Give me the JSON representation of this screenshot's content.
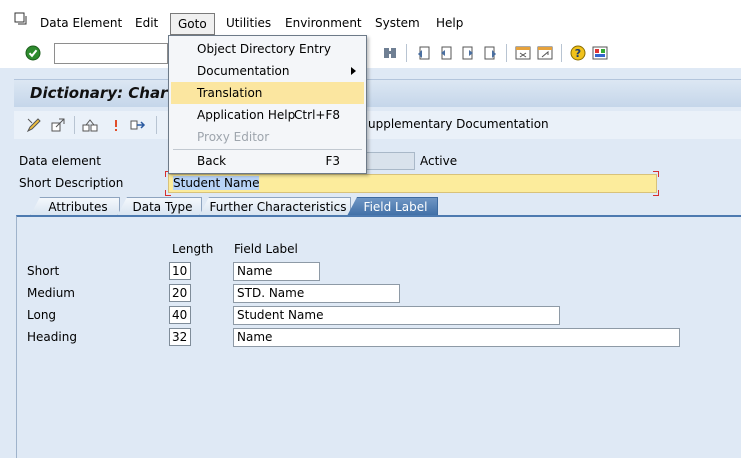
{
  "menubar": {
    "items": [
      {
        "label": "Data Element"
      },
      {
        "label": "Edit"
      },
      {
        "label": "Goto"
      },
      {
        "label": "Utilities"
      },
      {
        "label": "Environment"
      },
      {
        "label": "System"
      },
      {
        "label": "Help"
      }
    ],
    "open_menu": "Goto"
  },
  "goto_menu": {
    "items": [
      {
        "label": "Object Directory Entry",
        "shortcut": "",
        "submenu": false,
        "enabled": true
      },
      {
        "label": "Documentation",
        "shortcut": "",
        "submenu": true,
        "enabled": true
      },
      {
        "label": "Translation",
        "shortcut": "",
        "submenu": false,
        "enabled": true,
        "highlighted": true
      },
      {
        "label": "Application Help",
        "shortcut": "Ctrl+F8",
        "submenu": false,
        "enabled": true
      },
      {
        "label": "Proxy Editor",
        "shortcut": "",
        "submenu": false,
        "enabled": false
      },
      {
        "label": "Back",
        "shortcut": "F3",
        "submenu": false,
        "enabled": true
      }
    ]
  },
  "title": "Dictionary: Char",
  "app_toolbar": {
    "supplementary_doc_label": "upplementary Documentation"
  },
  "header": {
    "data_element_label": "Data element",
    "status": "Active",
    "short_desc_label": "Short Description",
    "short_desc_value": "Student Name"
  },
  "tabs": [
    {
      "label": "Attributes",
      "active": false
    },
    {
      "label": "Data Type",
      "active": false
    },
    {
      "label": "Further Characteristics",
      "active": false
    },
    {
      "label": "Field Label",
      "active": true
    }
  ],
  "field_label_tab": {
    "col_length": "Length",
    "col_field_label": "Field Label",
    "rows": [
      {
        "label": "Short",
        "length": "10",
        "value": "Name"
      },
      {
        "label": "Medium",
        "length": "20",
        "value": "STD. Name"
      },
      {
        "label": "Long",
        "length": "40",
        "value": "Student Name"
      },
      {
        "label": "Heading",
        "length": "32",
        "value": "Name"
      }
    ]
  },
  "colors": {
    "highlight": "#fbe6a0",
    "active_tab": "#4d7ab0",
    "required_field": "#fcec9c"
  }
}
